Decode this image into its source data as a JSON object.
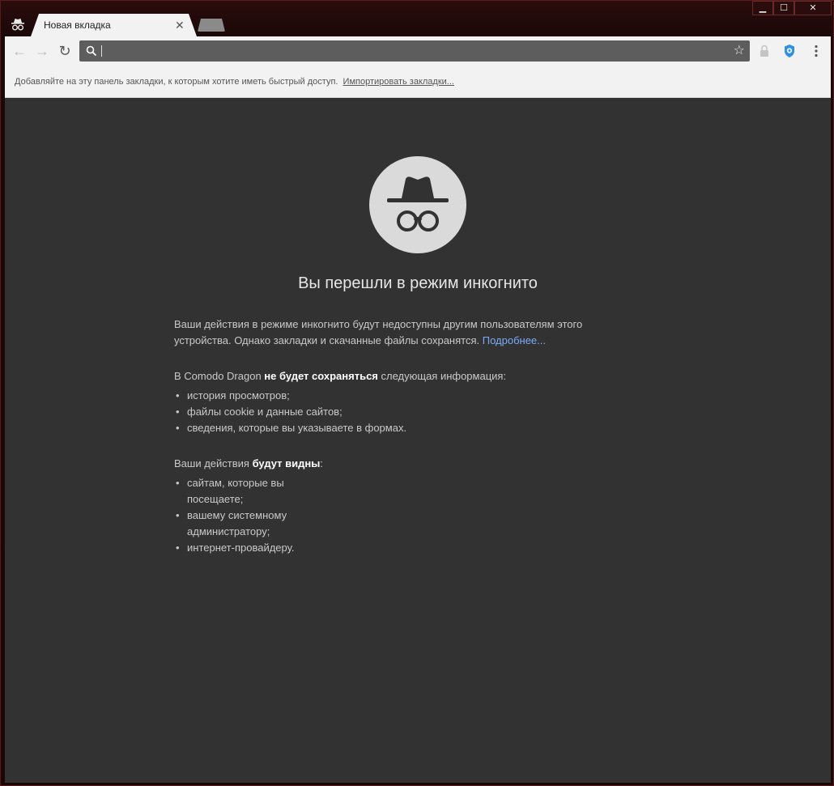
{
  "tab": {
    "title": "Новая вкладка",
    "close_glyph": "✕"
  },
  "window_controls": {
    "minimize": "▁",
    "maximize": "☐",
    "close": "✕"
  },
  "toolbar": {
    "back_glyph": "←",
    "forward_glyph": "→",
    "reload_glyph": "↻",
    "address_value": "",
    "bookmark_star_glyph": "☆"
  },
  "bookmarks_bar": {
    "message": "Добавляйте на эту панель закладки, к которым хотите иметь быстрый доступ.",
    "import_link": "Импортировать закладки..."
  },
  "incognito": {
    "headline": "Вы перешли в режим инкогнито",
    "intro": "Ваши действия в режиме инкогнито будут недоступны другим пользователям этого устройства. Однако закладки и скачанные файлы сохранятся. ",
    "learn_more": "Подробнее...",
    "not_saved_prefix": "В Comodo Dragon ",
    "not_saved_bold": "не будет сохраняться",
    "not_saved_suffix": " следующая информация:",
    "not_saved_items": [
      "история просмотров;",
      "файлы cookie и данные сайтов;",
      "сведения, которые вы указываете в формах."
    ],
    "visible_prefix": "Ваши действия ",
    "visible_bold": "будут видны",
    "visible_suffix": ":",
    "visible_items": [
      "сайтам, которые вы посещаете;",
      "вашему системному администратору;",
      "интернет-провайдеру."
    ]
  },
  "colors": {
    "content_bg": "#323232",
    "link": "#7babf7",
    "frame": "#2a0c0c"
  }
}
